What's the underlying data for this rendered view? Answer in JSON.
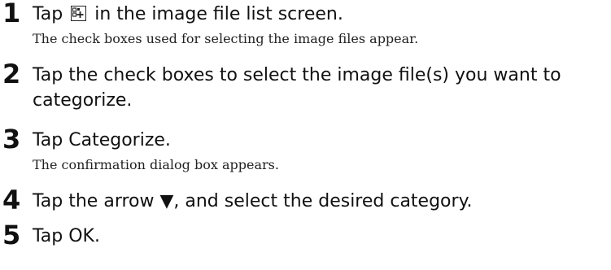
{
  "steps": [
    {
      "number": "1",
      "text_before": "Tap",
      "icon": "add-to-category-icon",
      "text_after": "in the image file list screen.",
      "note": "The check boxes used for selecting the image files appear."
    },
    {
      "number": "2",
      "text": "Tap the check boxes to select the image file(s) you want to categorize."
    },
    {
      "number": "3",
      "text": "Tap Categorize.",
      "note": "The confirmation dialog box appears."
    },
    {
      "number": "4",
      "text": "Tap the arrow ▼, and select the desired category."
    },
    {
      "number": "5",
      "text": "Tap OK."
    }
  ]
}
